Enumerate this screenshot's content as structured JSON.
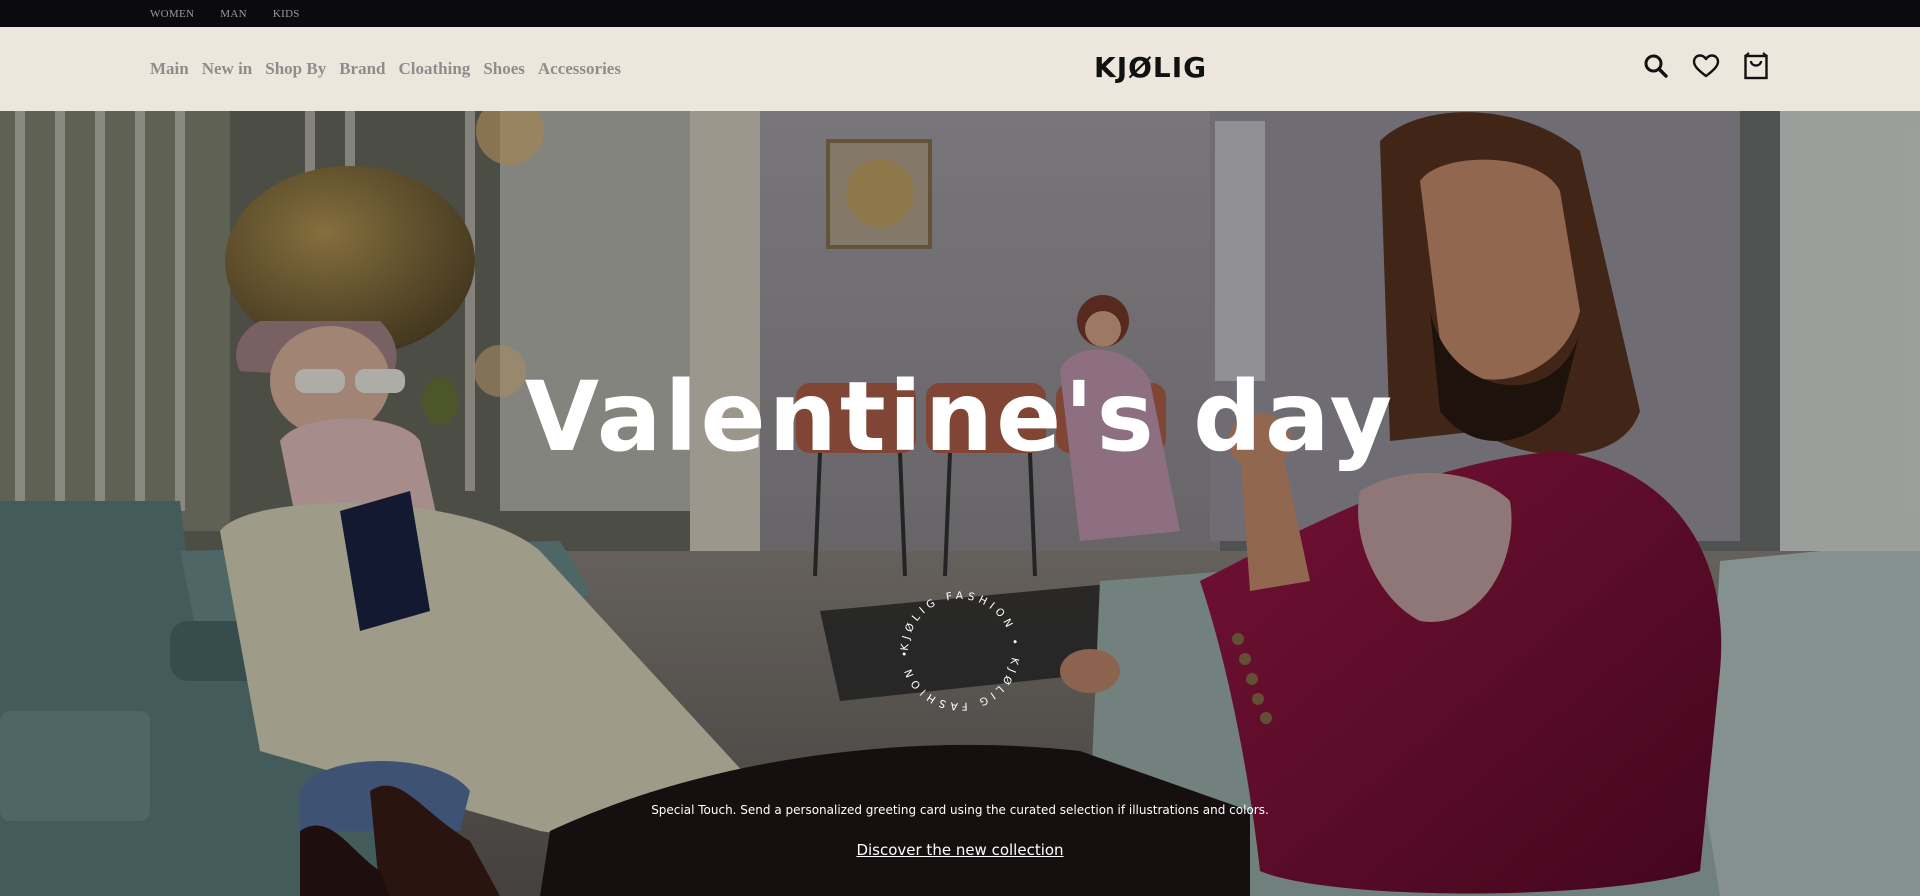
{
  "topbar": {
    "links": [
      "WOMEN",
      "MAN",
      "KIDS"
    ]
  },
  "header": {
    "nav": [
      "Main",
      "New in",
      "Shop By",
      "Brand",
      "Cloathing",
      "Shoes",
      "Accessories"
    ],
    "logo": "KJØLIG",
    "icons": [
      "search-icon",
      "heart-icon",
      "shopping-bag-icon"
    ]
  },
  "hero": {
    "title": "Valentine's day",
    "badge_text": "KJØLIG FASHION • KJØLIG FASHION •",
    "description": "Special Touch. Send a personalized greeting card using the curated selection if illustrations and colors.",
    "cta": "Discover the new collection"
  },
  "colors": {
    "topbar_bg": "#0b0b0f",
    "header_bg": "#ede6dd",
    "nav_text": "#8d8d8d",
    "velvet_jacket": "#8a1238",
    "chair_teal": "#5f7f7f"
  }
}
